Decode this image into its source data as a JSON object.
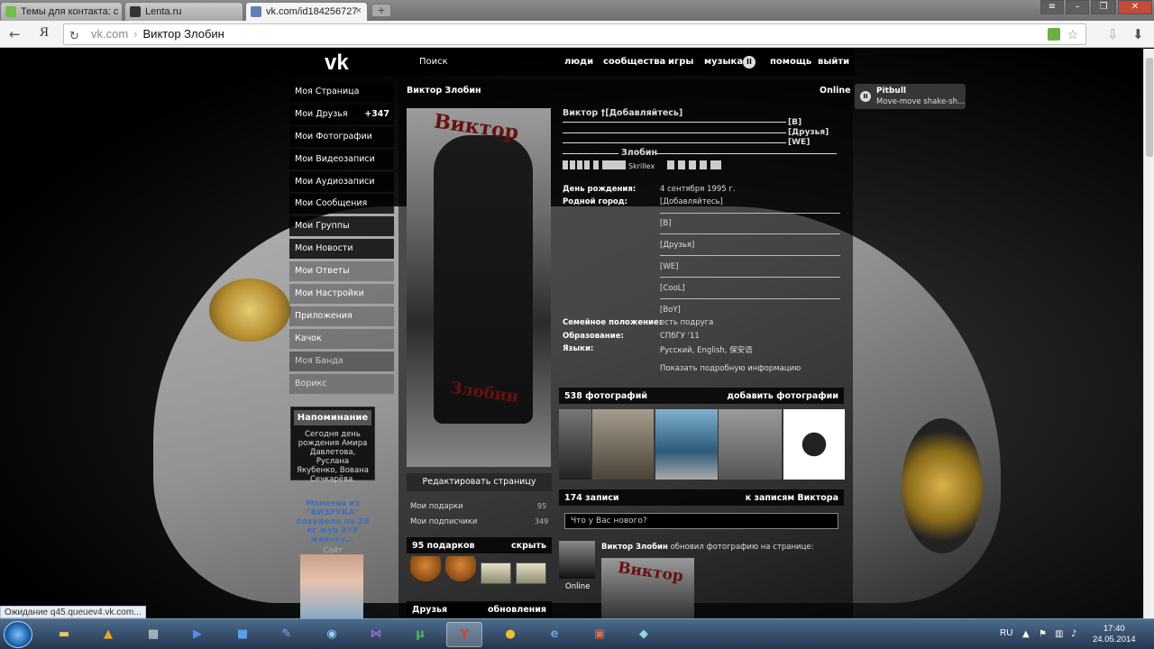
{
  "browser": {
    "tabs": [
      {
        "title": "Темы для контакта: с",
        "active": false,
        "favicon_color": "#6fbf4a"
      },
      {
        "title": "Lenta.ru",
        "active": false,
        "favicon_color": "#333333"
      },
      {
        "title": "vk.com/id184256727",
        "active": true,
        "favicon_color": "#5b82b8"
      }
    ],
    "new_tab_label": "+",
    "close_label": "×",
    "address_host": "vk.com",
    "address_title": "Виктор Злобин",
    "yandex_label": "Я",
    "status_text": "Ожидание q45.queuev4.vk.com..."
  },
  "vk": {
    "logo": "vk",
    "header": {
      "search": "Поиск",
      "people": "люди",
      "communities": "сообщества",
      "games": "игры",
      "music": "музыка",
      "help": "помощь",
      "logout": "выйти"
    },
    "menu": [
      {
        "label": "Моя Страница"
      },
      {
        "label": "Мои Друзья",
        "count": "+347"
      },
      {
        "label": "Мои Фотографии"
      },
      {
        "label": "Мои Видеозаписи"
      },
      {
        "label": "Мои Аудиозаписи"
      },
      {
        "label": "Мои Сообщения"
      },
      {
        "label": "Мои Группы"
      },
      {
        "label": "Мои Новости"
      },
      {
        "label": "Мои Ответы"
      },
      {
        "label": "Мои Настройки"
      },
      {
        "label": "Приложения"
      },
      {
        "label": "Качок"
      },
      {
        "label": "Моя Банда"
      },
      {
        "label": "Ворикс"
      }
    ],
    "reminder": {
      "title": "Напоминание",
      "text": "Сегодня день рождения Амира Давлетова, Руслана Якубенко, Вована Сечкарёва."
    },
    "ad": {
      "title": "Манаева из \"ВИЗРУКА\" похудела на 28 кг жуя ЭТУ жвачку...",
      "source": "Сайт"
    },
    "profile": {
      "name": "Виктор Злобин",
      "online": "Online",
      "avatar_top": "Виктор",
      "avatar_bottom": "Злобин",
      "edit_button": "Редактировать страницу",
      "gifts_link": "Мои подарки",
      "gifts_count": "95",
      "followers_link": "Мои подписчики",
      "followers_count": "349",
      "gifts_header": "95 подарков",
      "gifts_show": "скрыть",
      "friends_header": "Друзья",
      "friends_updates": "обновления",
      "status_title": "Виктор †[Добавляйтесь]",
      "status_tags": [
        "[B]",
        "[Друзья]",
        "[WE]"
      ],
      "surname_line": "Злобин",
      "skrillex": "Skrillex",
      "info": [
        {
          "key": "День рождения:",
          "value": "4 сентября 1995 г."
        },
        {
          "key": "Родной город:",
          "value": "[Добавляйтесь]"
        }
      ],
      "hometown_lines": [
        "[B]",
        "[Друзья]",
        "[WE]",
        "[CooL]",
        "[BoY]"
      ],
      "info2": [
        {
          "key": "Семейное положение:",
          "value": "есть подруга"
        },
        {
          "key": "Образование:",
          "value": "СПбГУ '11"
        },
        {
          "key": "Языки:",
          "value": "Русский, English, 保安语"
        }
      ],
      "show_more": "Показать подробную информацию",
      "photos_header": "538 фотографий",
      "photos_add": "добавить фотографии",
      "posts_header": "174 записи",
      "posts_link": "к записям Виктора",
      "post_placeholder": "Что у Вас нового?",
      "post_author": "Виктор Злобин",
      "post_action": "обновил фотографию на странице:",
      "post_online": "Online",
      "post_photo_text": "Виктор"
    },
    "player": {
      "artist": "Pitbull",
      "song": "Move-move shake-sh..."
    }
  },
  "taskbar": {
    "lang": "RU",
    "time": "17:40",
    "date": "24.05.2014"
  }
}
